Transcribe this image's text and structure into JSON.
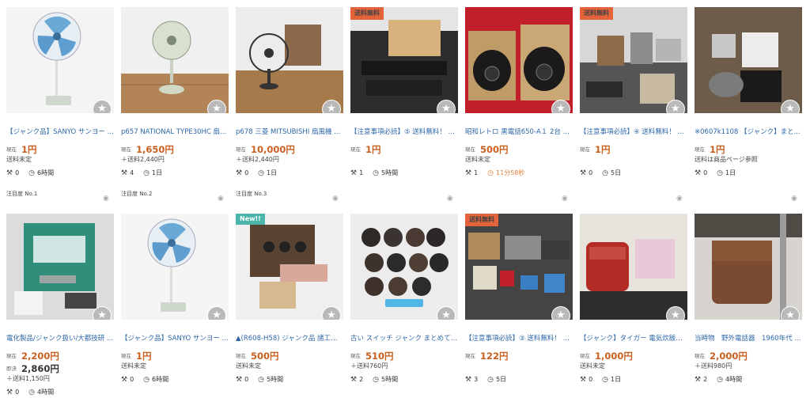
{
  "labels": {
    "current": "現在",
    "buynow": "即決"
  },
  "items": [
    {
      "title": "【ジャンク品】SANYO サンヨー ...",
      "price": "1円",
      "ship": "送料未定",
      "bids": "0",
      "time": "6時間",
      "rank": "注目度 No.1",
      "badge": ""
    },
    {
      "title": "p657 NATIONAL TYPE30HC 扇...",
      "price": "1,650円",
      "ship": "＋送料2,440円",
      "bids": "4",
      "time": "1日",
      "rank": "注目度 No.2",
      "badge": ""
    },
    {
      "title": "p678 三菱 MITSUBISHI 扇風機 ...",
      "price": "10,000円",
      "ship": "＋送料2,440円",
      "bids": "0",
      "time": "1日",
      "rank": "注目度 No.3",
      "badge": ""
    },
    {
      "title": "【注意事項必読】⑤ 送料無料！ ジ...",
      "price": "1円",
      "ship": "",
      "bids": "1",
      "time": "5時間",
      "rank": "",
      "badge": "送料無料"
    },
    {
      "title": "昭和レトロ 黒電話650-A１ 2台 ...",
      "price": "500円",
      "ship": "送料未定",
      "bids": "1",
      "time": "11分58秒",
      "rank": "",
      "badge": "",
      "red": true
    },
    {
      "title": "【注意事項必読】④ 送料無料！ ジ...",
      "price": "1円",
      "ship": "",
      "bids": "0",
      "time": "5日",
      "rank": "",
      "badge": "送料無料"
    },
    {
      "title": "※0607k1108 【ジャンク】まと...",
      "price": "1円",
      "ship": "送料は商品ページ参照",
      "bids": "0",
      "time": "1日",
      "rank": "",
      "badge": ""
    },
    {
      "title": "電化製品/ジャンク扱い/大都技研 ...",
      "price": "2,200円",
      "buynow": "2,860円",
      "ship": "＋送料1,150円",
      "bids": "0",
      "time": "4時間",
      "rank": "",
      "badge": ""
    },
    {
      "title": "【ジャンク品】SANYO サンヨー ...",
      "price": "1円",
      "ship": "送料未定",
      "bids": "0",
      "time": "6時間",
      "rank": "",
      "badge": ""
    },
    {
      "title": "▲(R608-H58) ジャンク品 諸工社...",
      "price": "500円",
      "ship": "送料未定",
      "bids": "0",
      "time": "5時間",
      "rank": "",
      "badge": "New!!"
    },
    {
      "title": "古い スイッチ ジャンク まとめて ...",
      "price": "510円",
      "ship": "＋送料760円",
      "bids": "2",
      "time": "5時間",
      "rank": "",
      "badge": ""
    },
    {
      "title": "【注意事項必読】③ 送料無料！ ジ...",
      "price": "122円",
      "ship": "",
      "bids": "3",
      "time": "5日",
      "rank": "",
      "badge": "送料無料"
    },
    {
      "title": "【ジャンク】タイガー 電気炊飯器 ...",
      "price": "1,000円",
      "ship": "送料未定",
      "bids": "0",
      "time": "1日",
      "rank": "",
      "badge": ""
    },
    {
      "title": "当時物　野外電話器　1960年代 ...",
      "price": "2,000円",
      "ship": "＋送料980円",
      "bids": "2",
      "time": "4時間",
      "rank": "",
      "badge": ""
    }
  ],
  "icons": {
    "star": "star-icon",
    "gavel": "gavel-icon",
    "clock": "clock-icon",
    "eye": "eye-icon"
  }
}
